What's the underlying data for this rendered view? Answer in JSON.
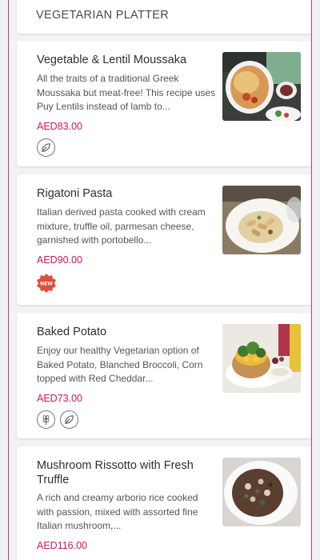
{
  "section": {
    "title": "VEGETARIAN PLATTER"
  },
  "items": [
    {
      "name": "Vegetable & Lentil Moussaka",
      "description": "All the traits of a traditional Greek Moussaka but meat-free! This recipe uses Puy Lentils instead of lamb to...",
      "price": "AED83.00",
      "badges": [
        "vegan-leaf-icon"
      ]
    },
    {
      "name": "Rigatoni Pasta",
      "description": "Italian derived pasta cooked with cream mixture, truffle oil, parmesan cheese, garnished with portobello...",
      "price": "AED90.00",
      "badges": [
        "new-badge"
      ],
      "new_label": "NEW"
    },
    {
      "name": "Baked Potato",
      "description": "Enjoy our healthy Vegetarian option of Baked Potato, Blanched Broccoli, Corn topped with Red Cheddar...",
      "price": "AED73.00",
      "badges": [
        "wheat-icon",
        "vegan-leaf-icon"
      ]
    },
    {
      "name": "Mushroom Rissotto with Fresh Truffle",
      "description": "A rich and creamy arborio rice cooked with passion, mixed with assorted fine Italian mushroom,...",
      "price": "AED116.00",
      "badges": []
    }
  ],
  "colors": {
    "accent": "#c8185f",
    "frame": "#c03a73",
    "new_badge": "#e04e3f"
  }
}
